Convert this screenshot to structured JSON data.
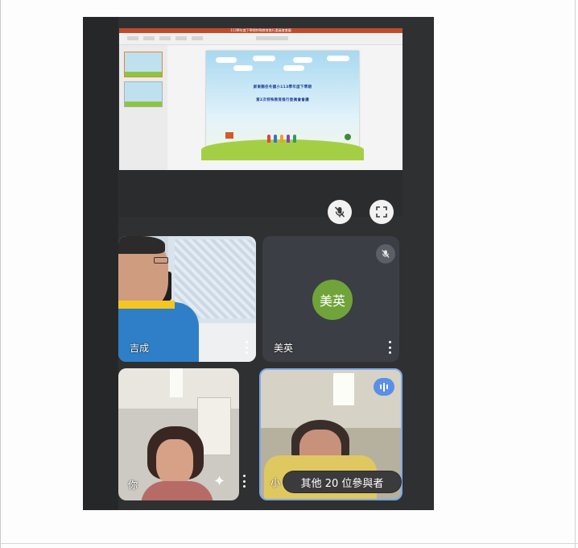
{
  "share": {
    "window_title": "113學年度下學期特殊教育推行委員會會議",
    "slide_line1": "屏東縣佳冬國小113學年度下學期",
    "slide_line2": "第2次特殊教育推行委員會會議"
  },
  "controls": {
    "mute_presentation_icon": "mic-off-icon",
    "fullscreen_icon": "fullscreen-icon"
  },
  "participants": [
    {
      "name": "吉成",
      "mic": "on"
    },
    {
      "name": "美英",
      "avatar_text": "美英",
      "avatar_color": "#70a43a",
      "mic": "muted"
    },
    {
      "name": "你",
      "effects_icon": "sparkle-icon"
    },
    {
      "name": "小",
      "speaking": true
    }
  ],
  "others": {
    "label": "其他 20 位參與者"
  },
  "colors": {
    "active_speaker_border": "#7ea8ea",
    "speaking_badge": "#5b8fe6"
  }
}
